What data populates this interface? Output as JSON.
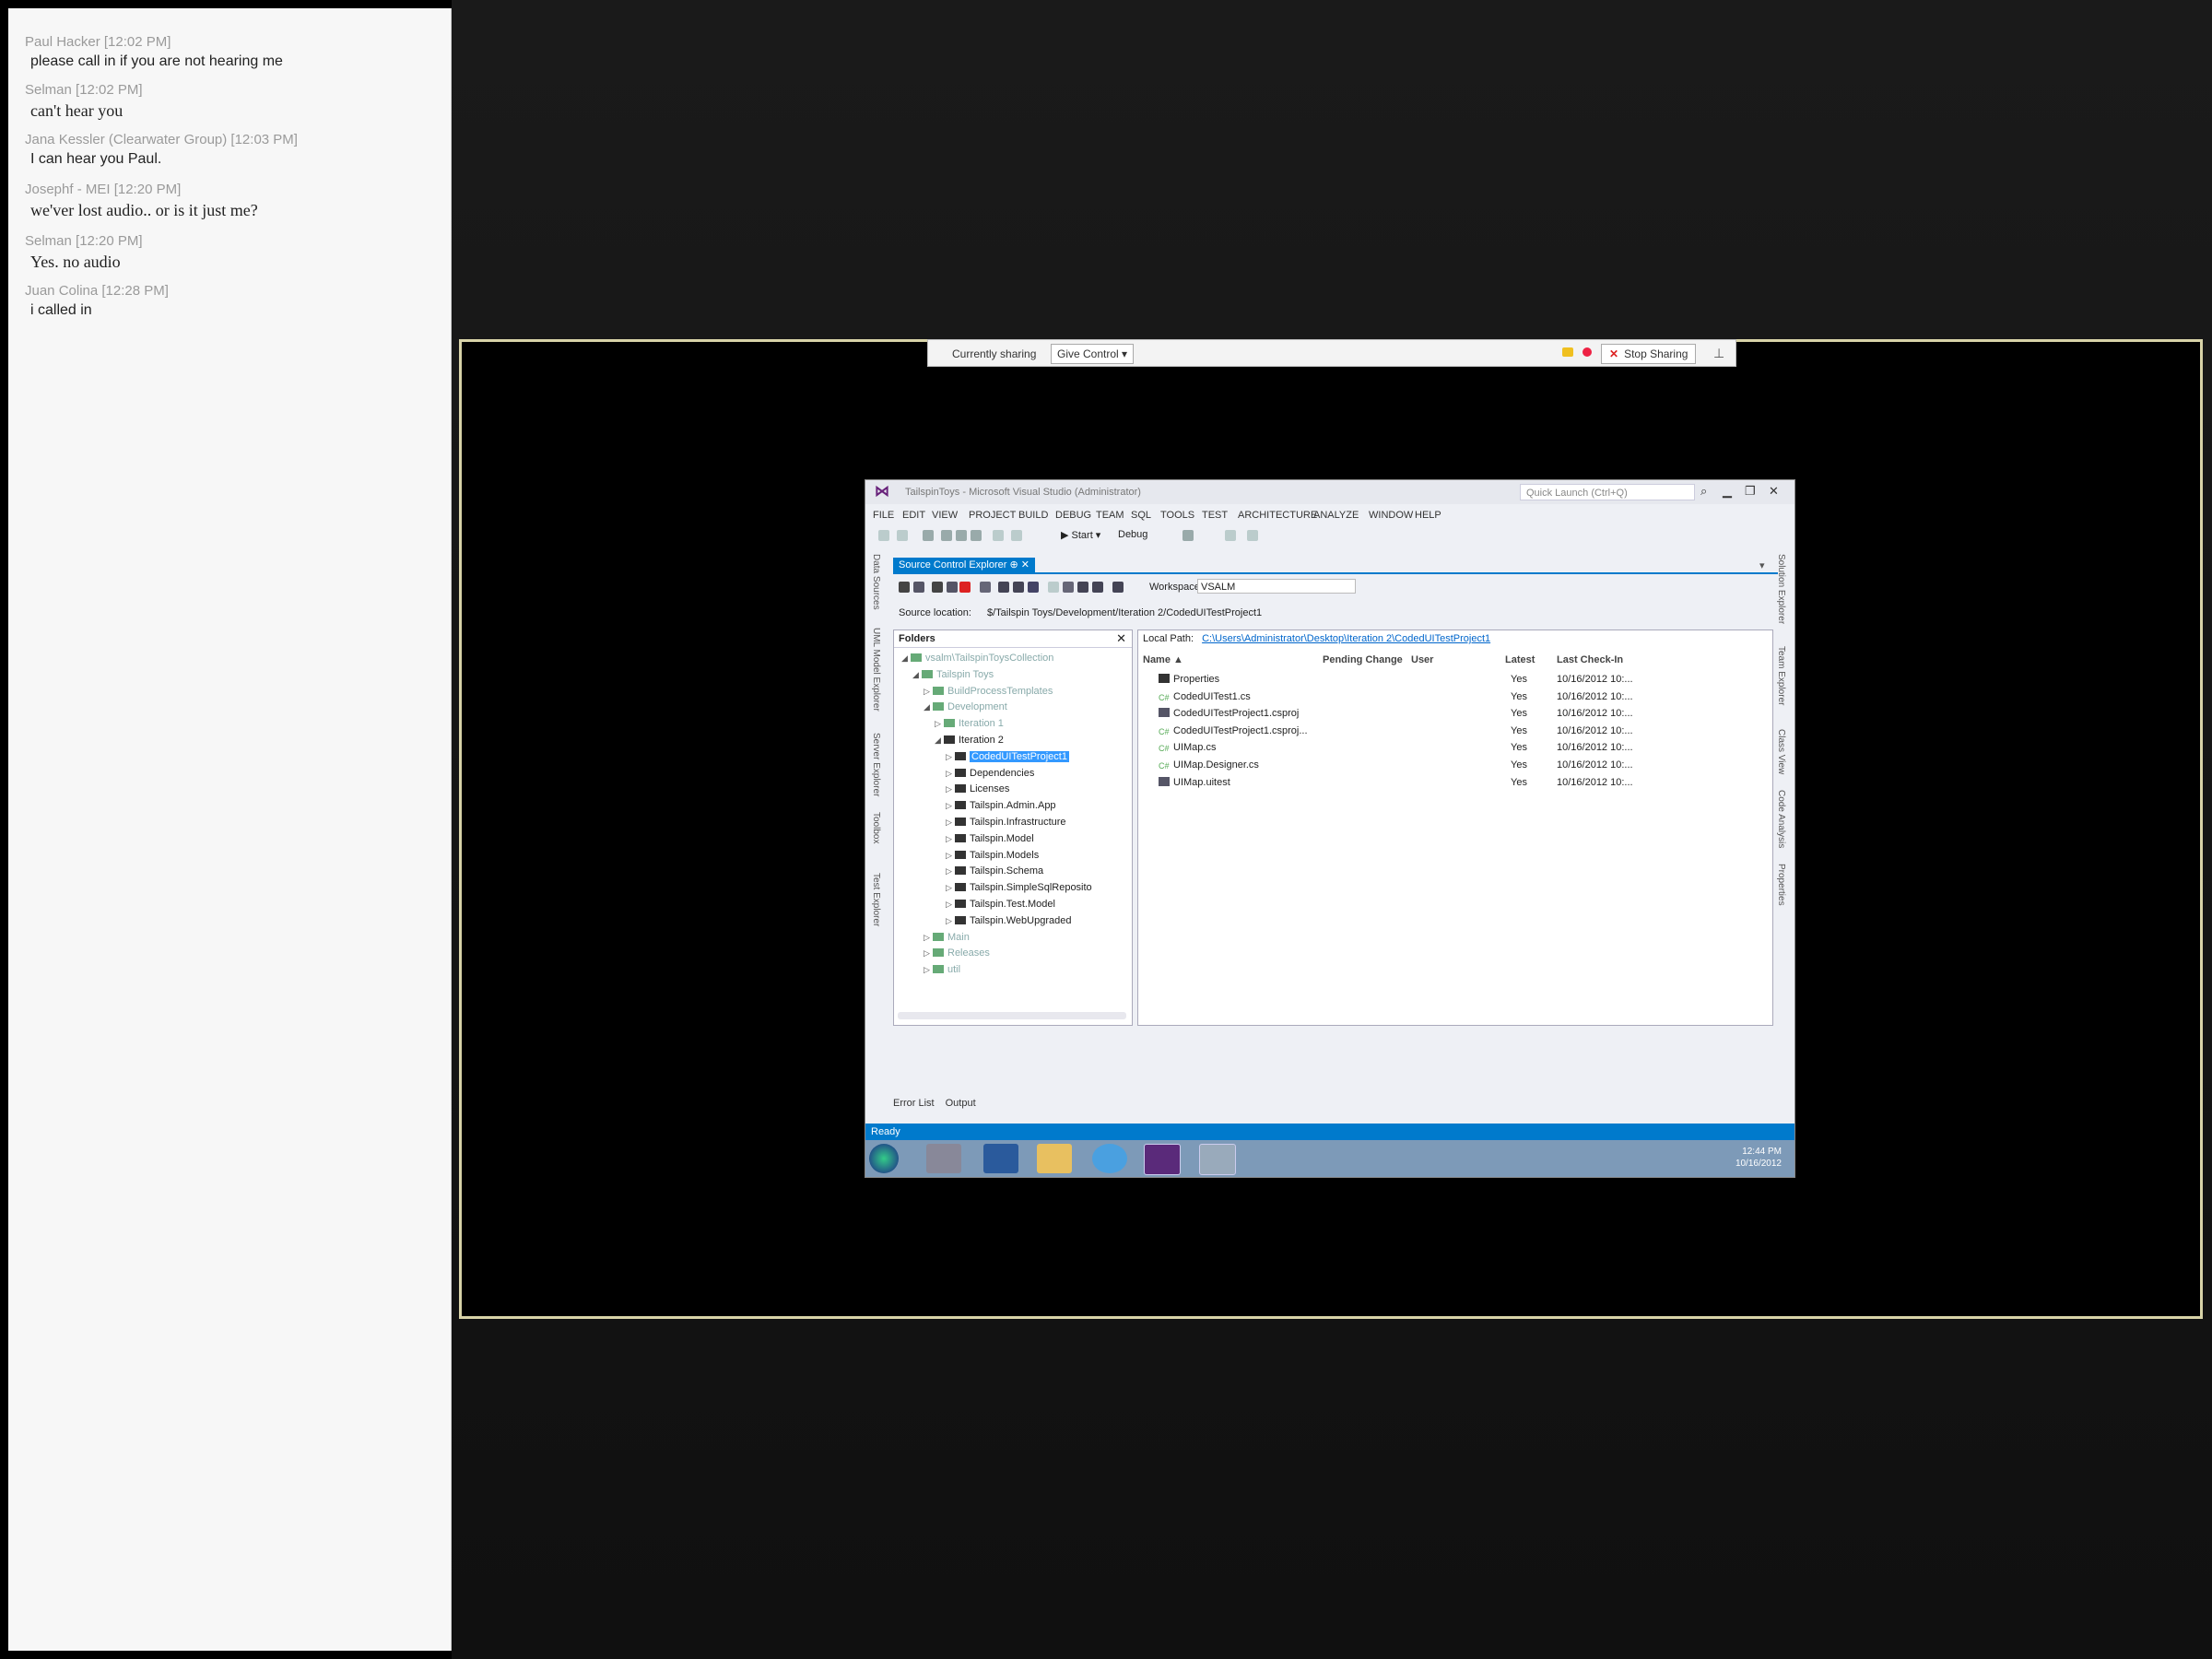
{
  "chat": {
    "messages": [
      {
        "who": "Paul Hacker [12:02 PM]",
        "text": "please call in if you are not hearing me",
        "serif": false
      },
      {
        "who": "Selman [12:02 PM]",
        "text": "can't hear you",
        "serif": true
      },
      {
        "who": "Jana Kessler (Clearwater Group) [12:03 PM]",
        "text": "I can hear you Paul.",
        "serif": false
      },
      {
        "who": "Josephf - MEI [12:20 PM]",
        "text": "we'ver lost audio.. or is it just me?",
        "serif": true
      },
      {
        "who": "Selman [12:20 PM]",
        "text": "Yes. no audio",
        "serif": true
      },
      {
        "who": "Juan Colina [12:28 PM]",
        "text": "i called in",
        "serif": false
      }
    ]
  },
  "share_bar": {
    "status": "Currently sharing",
    "give_control": "Give Control ▾",
    "stop_sharing": "Stop Sharing"
  },
  "vs": {
    "title": "TailspinToys - Microsoft Visual Studio (Administrator)",
    "quick_launch": "Quick Launch (Ctrl+Q)",
    "menu": [
      "FILE",
      "EDIT",
      "VIEW",
      "PROJECT",
      "BUILD",
      "DEBUG",
      "TEAM",
      "SQL",
      "TOOLS",
      "TEST",
      "ARCHITECTURE",
      "ANALYZE",
      "WINDOW",
      "HELP"
    ],
    "toolbar": {
      "start": "▶ Start ▾",
      "config": "Debug"
    },
    "left_dock": [
      "Data Sources",
      "UML Model Explorer",
      "Server Explorer",
      "Toolbox",
      "Test Explorer"
    ],
    "right_dock": [
      "Solution Explorer",
      "Team Explorer",
      "Class View",
      "Code Analysis",
      "Properties"
    ],
    "doc_tab": "Source Control Explorer  ⊕  ✕",
    "workspace_label": "Workspace:",
    "workspace_value": "VSALM",
    "source_location_label": "Source location:",
    "source_location_value": "$/Tailspin Toys/Development/Iteration 2/CodedUITestProject1",
    "folders_title": "Folders",
    "tree": [
      {
        "label": "vsalm\\TailspinToysCollection",
        "depth": 0,
        "arrow": "◢",
        "dim": true
      },
      {
        "label": "Tailspin Toys",
        "depth": 1,
        "arrow": "◢",
        "dim": true
      },
      {
        "label": "BuildProcessTemplates",
        "depth": 2,
        "arrow": "▷",
        "dim": true
      },
      {
        "label": "Development",
        "depth": 2,
        "arrow": "◢",
        "dim": true
      },
      {
        "label": "Iteration 1",
        "depth": 3,
        "arrow": "▷",
        "dim": true
      },
      {
        "label": "Iteration 2",
        "depth": 3,
        "arrow": "◢",
        "dim": false
      },
      {
        "label": "CodedUITestProject1",
        "depth": 4,
        "arrow": "▷",
        "dim": false,
        "selected": true
      },
      {
        "label": "Dependencies",
        "depth": 4,
        "arrow": "▷",
        "dim": false
      },
      {
        "label": "Licenses",
        "depth": 4,
        "arrow": "▷",
        "dim": false
      },
      {
        "label": "Tailspin.Admin.App",
        "depth": 4,
        "arrow": "▷",
        "dim": false
      },
      {
        "label": "Tailspin.Infrastructure",
        "depth": 4,
        "arrow": "▷",
        "dim": false
      },
      {
        "label": "Tailspin.Model",
        "depth": 4,
        "arrow": "▷",
        "dim": false
      },
      {
        "label": "Tailspin.Models",
        "depth": 4,
        "arrow": "▷",
        "dim": false
      },
      {
        "label": "Tailspin.Schema",
        "depth": 4,
        "arrow": "▷",
        "dim": false
      },
      {
        "label": "Tailspin.SimpleSqlReposito",
        "depth": 4,
        "arrow": "▷",
        "dim": false
      },
      {
        "label": "Tailspin.Test.Model",
        "depth": 4,
        "arrow": "▷",
        "dim": false
      },
      {
        "label": "Tailspin.WebUpgraded",
        "depth": 4,
        "arrow": "▷",
        "dim": false
      },
      {
        "label": "Main",
        "depth": 2,
        "arrow": "▷",
        "dim": true
      },
      {
        "label": "Releases",
        "depth": 2,
        "arrow": "▷",
        "dim": true
      },
      {
        "label": "util",
        "depth": 2,
        "arrow": "▷",
        "dim": true
      }
    ],
    "local_path_label": "Local Path:",
    "local_path_value": "C:\\Users\\Administrator\\Desktop\\Iteration 2\\CodedUITestProject1",
    "columns": [
      "Name ▲",
      "Pending Change",
      "User",
      "Latest",
      "Last Check-In"
    ],
    "files": [
      {
        "name": "Properties",
        "latest": "Yes",
        "checkin": "10/16/2012 10:...",
        "icon": "folder"
      },
      {
        "name": "CodedUITest1.cs",
        "latest": "Yes",
        "checkin": "10/16/2012 10:...",
        "icon": "cs"
      },
      {
        "name": "CodedUITestProject1.csproj",
        "latest": "Yes",
        "checkin": "10/16/2012 10:...",
        "icon": "proj"
      },
      {
        "name": "CodedUITestProject1.csproj...",
        "latest": "Yes",
        "checkin": "10/16/2012 10:...",
        "icon": "cs"
      },
      {
        "name": "UIMap.cs",
        "latest": "Yes",
        "checkin": "10/16/2012 10:...",
        "icon": "cs"
      },
      {
        "name": "UIMap.Designer.cs",
        "latest": "Yes",
        "checkin": "10/16/2012 10:...",
        "icon": "cs"
      },
      {
        "name": "UIMap.uitest",
        "latest": "Yes",
        "checkin": "10/16/2012 10:...",
        "icon": "proj"
      }
    ],
    "bottom_tabs": [
      "Error List",
      "Output"
    ],
    "status": "Ready",
    "clock_time": "12:44 PM",
    "clock_date": "10/16/2012"
  }
}
